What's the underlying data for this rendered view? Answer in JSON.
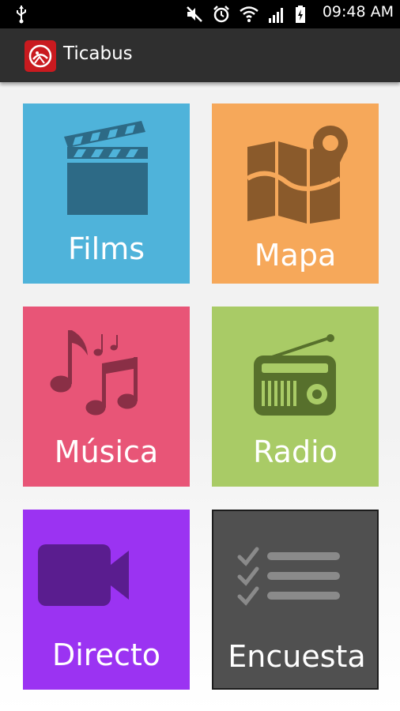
{
  "status_bar": {
    "time": "09:48 AM",
    "icons": [
      "usb-icon",
      "mute-icon",
      "alarm-icon",
      "wifi-icon",
      "signal-icon",
      "battery-icon"
    ]
  },
  "app": {
    "title": "Ticabus",
    "logo_color": "#c91a1f"
  },
  "tiles": [
    {
      "label": "Films",
      "icon": "film-clapperboard-icon",
      "color": "#4fb3da"
    },
    {
      "label": "Mapa",
      "icon": "map-pin-icon",
      "color": "#f6a85a"
    },
    {
      "label": "Música",
      "icon": "music-notes-icon",
      "color": "#e85577"
    },
    {
      "label": "Radio",
      "icon": "radio-icon",
      "color": "#a9cb66"
    },
    {
      "label": "Directo",
      "icon": "video-camera-icon",
      "color": "#9b33f2"
    },
    {
      "label": "Encuesta",
      "icon": "checklist-icon",
      "color": "#505050"
    }
  ]
}
